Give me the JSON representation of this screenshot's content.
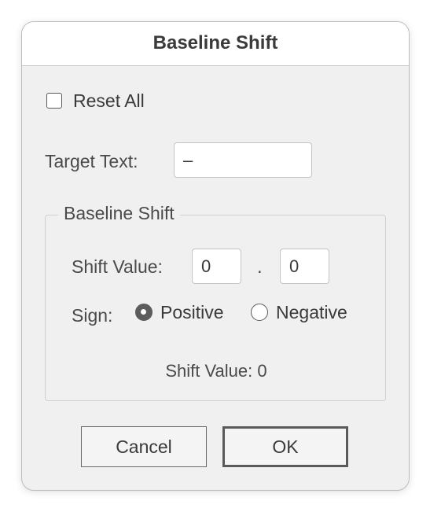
{
  "dialog": {
    "title": "Baseline Shift"
  },
  "reset_all": {
    "label": "Reset All",
    "checked": false
  },
  "target_text": {
    "label": "Target Text:",
    "value": "–"
  },
  "group": {
    "legend": "Baseline Shift",
    "shift_value_label": "Shift Value:",
    "integer_value": "0",
    "decimal_separator": ".",
    "decimal_value": "0",
    "sign_label": "Sign:",
    "sign_options": [
      {
        "label": "Positive",
        "selected": true
      },
      {
        "label": "Negative",
        "selected": false
      }
    ],
    "status_text": "Shift Value: 0"
  },
  "buttons": {
    "cancel_label": "Cancel",
    "ok_label": "OK"
  },
  "colors": {
    "dialog_bg": "#f0f0f0",
    "titlebar_bg": "#ffffff",
    "text": "#3a3a3a",
    "border": "#c4c4c4"
  }
}
